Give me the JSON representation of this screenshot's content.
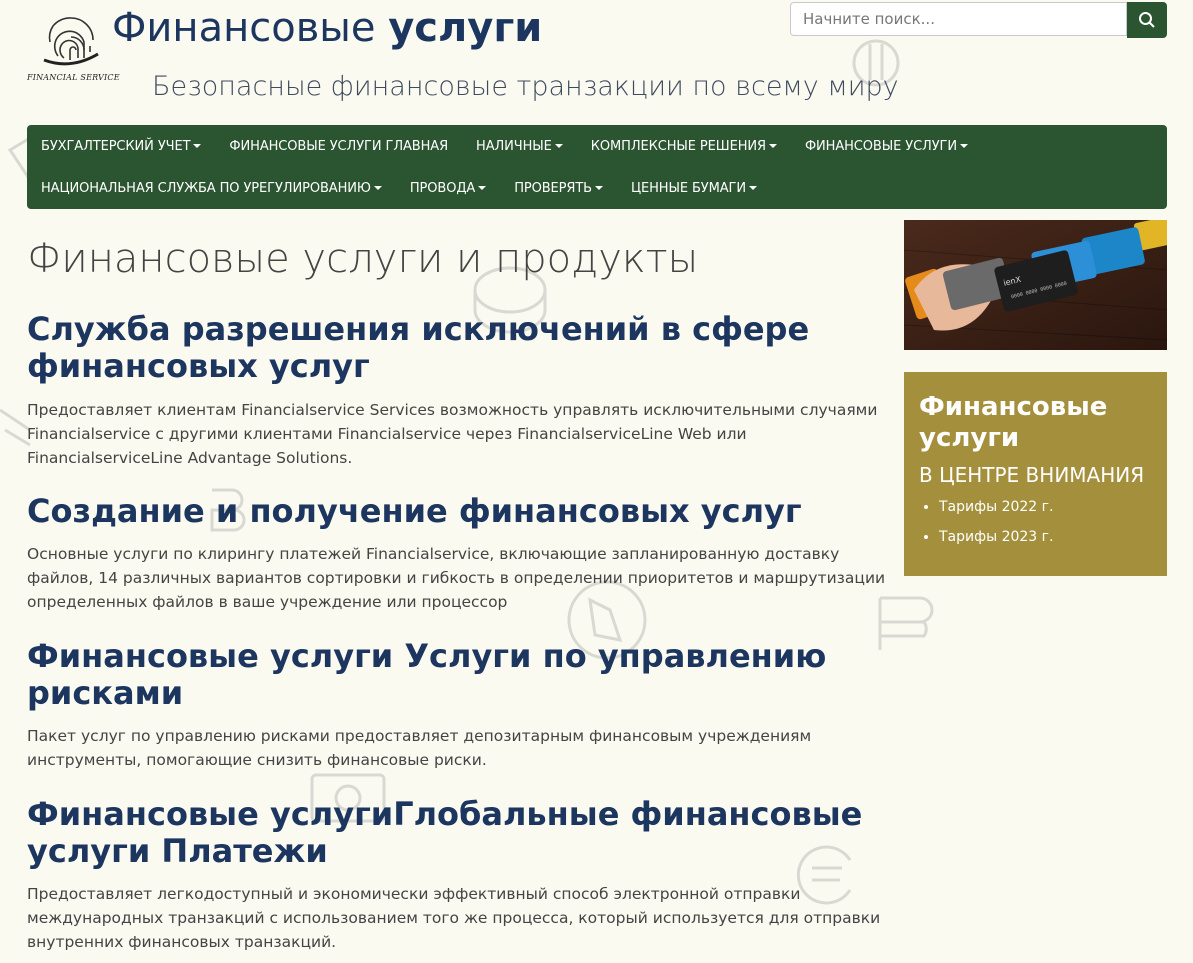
{
  "header": {
    "logo_caption": "FINANCIAL SERVICE",
    "title_regular": "Финансовые",
    "title_bold": "услуги",
    "tagline": "Безопасные финансовые транзакции по всему миру"
  },
  "search": {
    "placeholder": "Начните поиск..."
  },
  "nav": {
    "items": [
      {
        "label": "БУХГАЛТЕРСКИЙ УЧЕТ"
      },
      {
        "label": "ФИНАНСОВЫЕ УСЛУГИ ГЛАВНАЯ"
      },
      {
        "label": "НАЛИЧНЫЕ"
      },
      {
        "label": "КОМПЛЕКСНЫЕ РЕШЕНИЯ"
      },
      {
        "label": "ФИНАНСОВЫЕ УСЛУГИ"
      },
      {
        "label": "НАЦИОНАЛЬНАЯ СЛУЖБА ПО УРЕГУЛИРОВАНИЮ"
      },
      {
        "label": "ПРОВОДА"
      },
      {
        "label": "ПРОВЕРЯТЬ"
      },
      {
        "label": "ЦЕННЫЕ БУМАГИ"
      }
    ]
  },
  "main": {
    "page_title": "Финансовые услуги и продукты",
    "sections": [
      {
        "heading": "Служба разрешения исключений в сфере финансовых услуг",
        "text": "Предоставляет клиентам Financialservice Services возможность управлять исключительными случаями Financialservice с другими клиентами Financialservice через FinancialserviceLine Web или FinancialserviceLine Advantage Solutions."
      },
      {
        "heading": "Создание и получение финансовых услуг",
        "text": "Основные услуги по клирингу платежей Financialservice, включающие запланированную доставку файлов, 14 различных вариантов сортировки и гибкость в определении приоритетов и маршрутизации определенных файлов в ваше учреждение или процессор"
      },
      {
        "heading": "Финансовые услуги Услуги по управлению рисками",
        "text": "Пакет услуг по управлению рисками предоставляет депозитарным финансовым учреждениям инструменты, помогающие снизить финансовые риски."
      },
      {
        "heading": "Финансовые услугиГлобальные финансовые услуги Платежи",
        "text": "Предоставляет легкодоступный и экономически эффективный способ электронной отправки международных транзакций с использованием того же процесса, который используется для отправки внутренних финансовых транзакций."
      }
    ]
  },
  "sidebar": {
    "card_text": "ienX",
    "card_number": "0000 0000 0000 0000",
    "spotlight_title": "Финансовые услуги",
    "spotlight_subtitle": "В ЦЕНТРЕ ВНИМАНИЯ",
    "links": [
      {
        "label": "Тарифы 2022 г."
      },
      {
        "label": "Тарифы 2023 г."
      }
    ]
  },
  "colors": {
    "background": "#fbfaf0",
    "nav_green": "#2b5530",
    "heading_navy": "#1c3660",
    "spotlight_gold": "#a48f3c"
  }
}
